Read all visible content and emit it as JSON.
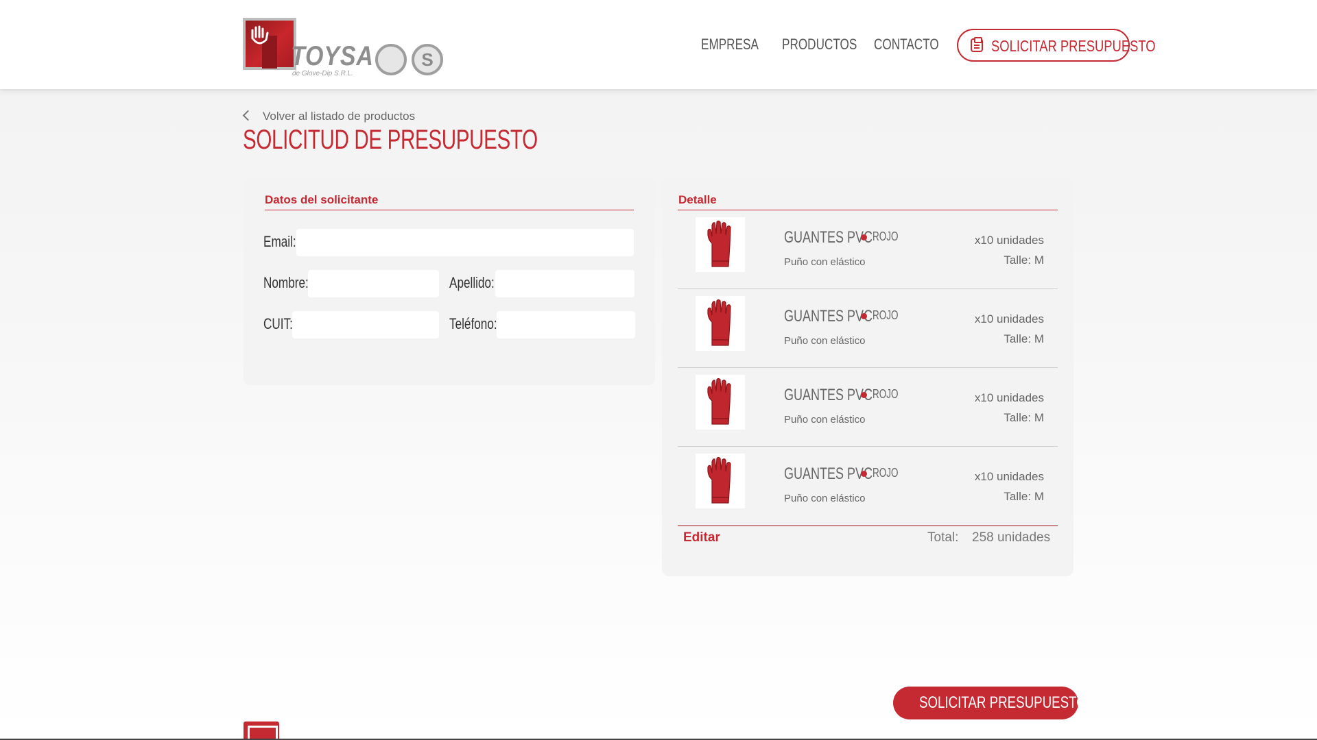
{
  "brand": {
    "name": "TOYSA",
    "subtitle": "de Glove-Dip S.R.L."
  },
  "nav": {
    "empresa": "EMPRESA",
    "productos": "PRODUCTOS",
    "contacto": "CONTACTO",
    "cta": "SOLICITAR PRESUPUESTO"
  },
  "page": {
    "back_label": "Volver al listado de productos",
    "title": "SOLICITUD DE PRESUPUESTO"
  },
  "form": {
    "section_title": "Datos del solicitante",
    "email_label": "Email:",
    "email_value": "",
    "nombre_label": "Nombre:",
    "nombre_value": "",
    "apellido_label": "Apellido:",
    "apellido_value": "",
    "cuit_label": "CUIT:",
    "cuit_value": "",
    "telefono_label": "Teléfono:",
    "telefono_value": ""
  },
  "detail": {
    "section_title": "Detalle",
    "items": [
      {
        "name": "GUANTES PVC",
        "color": "ROJO",
        "description": "Puño con elástico",
        "quantity": "x10 unidades",
        "size": "Talle: M"
      },
      {
        "name": "GUANTES PVC",
        "color": "ROJO",
        "description": "Puño con elástico",
        "quantity": "x10 unidades",
        "size": "Talle: M"
      },
      {
        "name": "GUANTES PVC",
        "color": "ROJO",
        "description": "Puño con elástico",
        "quantity": "x10 unidades",
        "size": "Talle: M"
      },
      {
        "name": "GUANTES PVC",
        "color": "ROJO",
        "description": "Puño con elástico",
        "quantity": "x10 unidades",
        "size": "Talle: M"
      }
    ],
    "edit_label": "Editar",
    "total_label": "Total:",
    "total_value": "258 unidades"
  },
  "submit_label": "SOLICITAR PRESUPUESTO",
  "colors": {
    "accent": "#c52a32",
    "panel": "#f3f3f3",
    "text": "#555555"
  },
  "icons": {
    "back": "chevron-left-icon",
    "cta": "clipboard-icon",
    "item_color": "color-dot-icon"
  }
}
